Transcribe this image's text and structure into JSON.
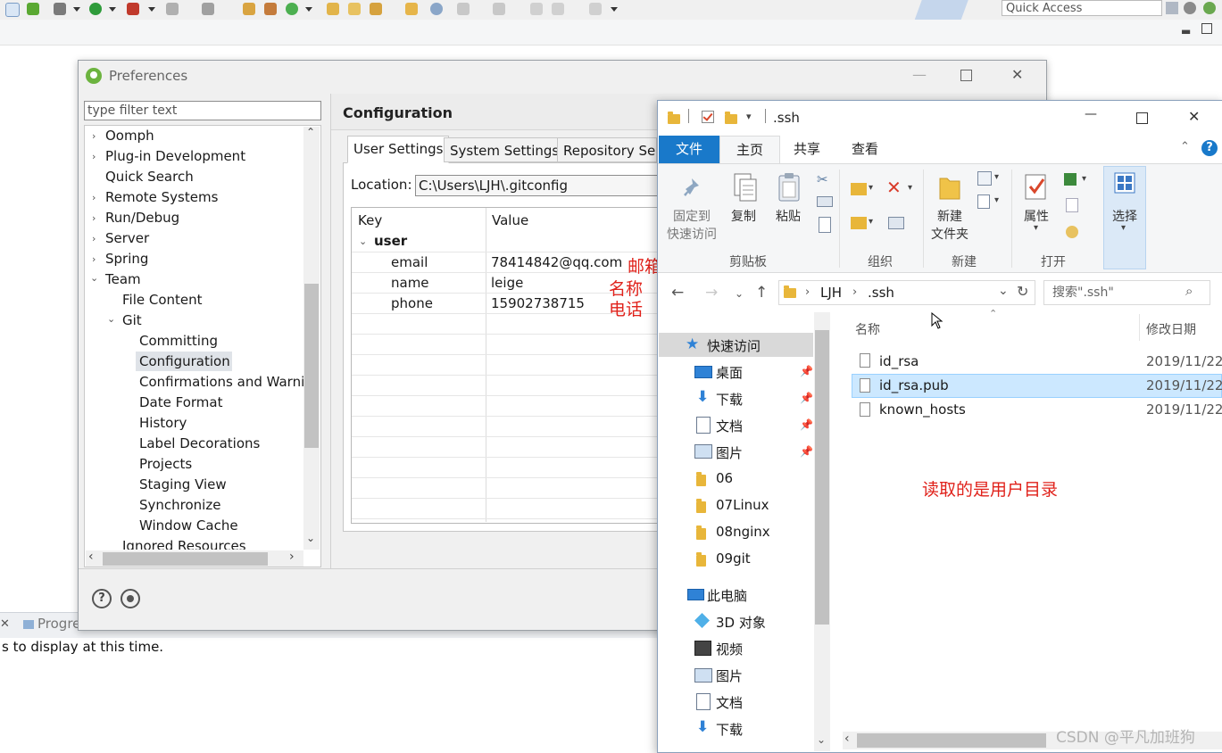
{
  "eclipse": {
    "quick_access": "Quick Access",
    "progress_tab": "Progre",
    "progress_text": "s to display at this time."
  },
  "preferences": {
    "title": "Preferences",
    "filter_placeholder": "type filter text",
    "tree": {
      "oomph": "Oomph",
      "plugin": "Plug-in Development",
      "quick_search": "Quick Search",
      "remote": "Remote Systems",
      "rundebug": "Run/Debug",
      "server": "Server",
      "spring": "Spring",
      "team": "Team",
      "file_content": "File Content",
      "git": "Git",
      "committing": "Committing",
      "configuration": "Configuration",
      "confirmations": "Confirmations and Warnir",
      "date_format": "Date Format",
      "history": "History",
      "label_decorations": "Label Decorations",
      "projects": "Projects",
      "staging": "Staging View",
      "synchronize": "Synchronize",
      "window_cache": "Window Cache",
      "ignored": "Ignored Resources"
    },
    "page_title": "Configuration",
    "tabs": {
      "user": "User Settings",
      "system": "System Settings",
      "repository": "Repository Se"
    },
    "location_label": "Location:",
    "location_value": "C:\\Users\\LJH\\.gitconfig",
    "table": {
      "key_header": "Key",
      "value_header": "Value",
      "section": "user",
      "rows": [
        {
          "key": "email",
          "value": "78414842@qq.com"
        },
        {
          "key": "name",
          "value": "leige"
        },
        {
          "key": "phone",
          "value": "15902738715"
        }
      ]
    },
    "annotations": {
      "email": "邮箱",
      "name": "名称",
      "phone": "电话"
    },
    "help_glyph": "?"
  },
  "explorer": {
    "title": ".ssh",
    "ribbon_tabs": {
      "file": "文件",
      "home": "主页",
      "share": "共享",
      "view": "查看"
    },
    "ribbon": {
      "pin": "固定到\n快速访问",
      "copy": "复制",
      "paste": "粘贴",
      "new_folder": "新建\n文件夹",
      "properties": "属性",
      "select": "选择",
      "groups": {
        "clipboard": "剪贴板",
        "organize": "组织",
        "new": "新建",
        "open": "打开"
      }
    },
    "address": {
      "crumb1": "LJH",
      "crumb2": ".ssh",
      "search_placeholder": "搜索\".ssh\""
    },
    "nav": {
      "quick_access": "快速访问",
      "desktop": "桌面",
      "downloads": "下载",
      "documents": "文档",
      "pictures": "图片",
      "f06": "06",
      "f07": "07Linux",
      "f08": "08nginx",
      "f09": "09git",
      "this_pc": "此电脑",
      "objects3d": "3D 对象",
      "videos": "视频",
      "pictures2": "图片",
      "documents2": "文档",
      "downloads2": "下载"
    },
    "columns": {
      "name": "名称",
      "date": "修改日期"
    },
    "files": [
      {
        "name": "id_rsa",
        "date": "2019/11/22"
      },
      {
        "name": "id_rsa.pub",
        "date": "2019/11/22"
      },
      {
        "name": "known_hosts",
        "date": "2019/11/22"
      }
    ],
    "annotation": "读取的是用户目录"
  },
  "watermark": "CSDN @平凡加班狗",
  "colors": {
    "accent_blue": "#1979ca",
    "annotation_red": "#e0221b",
    "selection_blue": "#cce8ff"
  }
}
